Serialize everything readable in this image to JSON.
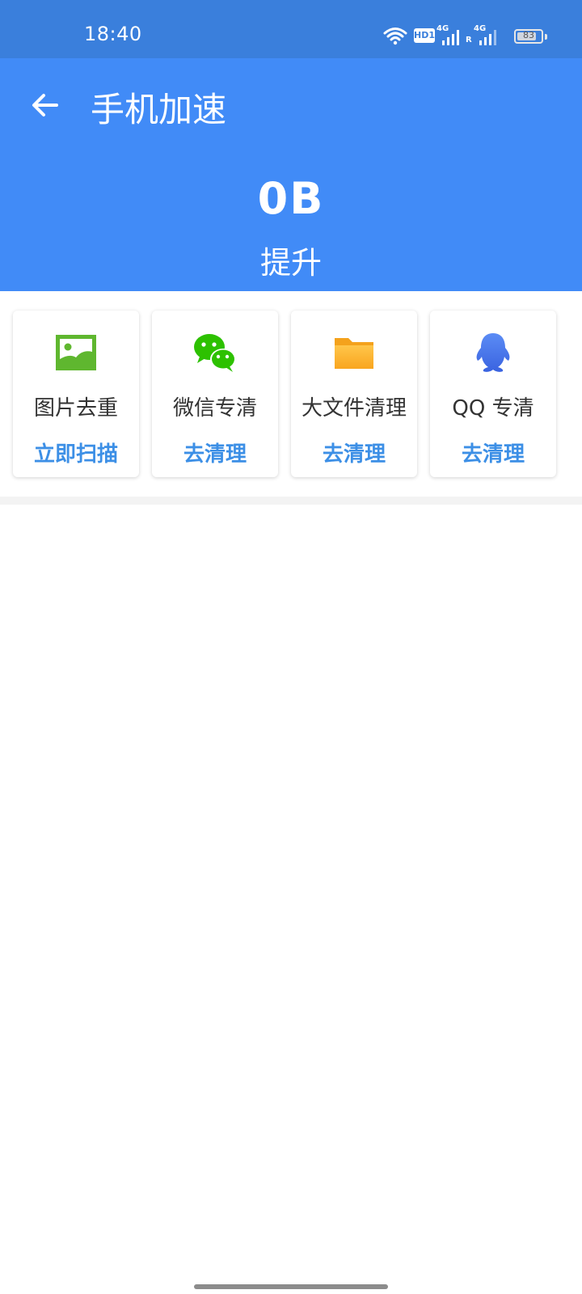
{
  "status_bar": {
    "time": "18:40",
    "hd_label": "HD1",
    "network_1": "4G",
    "network_2": "4G",
    "roaming_label": "R",
    "battery_level": "83",
    "battery_fraction": 0.83,
    "icons": [
      "wifi-icon",
      "hd-voice-icon",
      "signal-icon",
      "signal-icon",
      "battery-icon"
    ]
  },
  "header": {
    "title": "手机加速",
    "size_value": "0B",
    "boost_label": "提升",
    "back_icon": "arrow-left-icon"
  },
  "cards": [
    {
      "title": "图片去重",
      "action": "立即扫描",
      "icon": "image-icon"
    },
    {
      "title": "微信专清",
      "action": "去清理",
      "icon": "wechat-icon"
    },
    {
      "title": "大文件清理",
      "action": "去清理",
      "icon": "folder-icon"
    },
    {
      "title": "QQ 专清",
      "action": "去清理",
      "icon": "qq-icon"
    }
  ],
  "colors": {
    "status_bar": "#3a7fdc",
    "header": "#418bf7",
    "action_text": "#3c8fe6",
    "card_title": "#333333"
  }
}
